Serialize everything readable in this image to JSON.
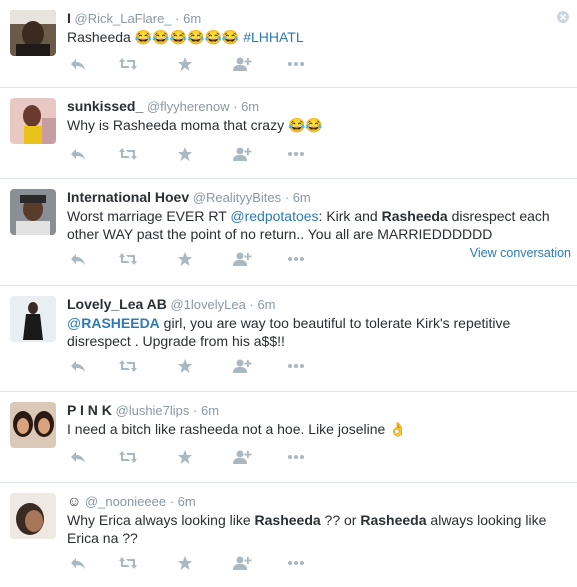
{
  "colors": {
    "link": "#2b7bb9",
    "meta": "#8899a6",
    "icon": "#aab8c2",
    "text": "#292f33",
    "divider": "#e1e8ed"
  },
  "tweets": [
    {
      "fullname": "I",
      "username": "@Rick_LaFlare_",
      "sep": "·",
      "time": "6m",
      "text_pre": "Rasheeda 😂😂😂😂😂😂 ",
      "hashtag": "#LHHATL"
    },
    {
      "fullname": "sunkissed_",
      "username": "@flyyherenow",
      "sep": "·",
      "time": "6m",
      "text": "Why is Rasheeda moma that crazy 😂😂"
    },
    {
      "fullname": "International Hoev",
      "username": "@RealityyBites",
      "sep": "·",
      "time": "6m",
      "text_a": "Worst marriage EVER RT ",
      "mention": "@redpotatoes",
      "text_b": ": Kirk and ",
      "bold": "Rasheeda",
      "text_c": " disrespect each other WAY past the point of no return.. You all are MARRIEDDDDDD",
      "view_conversation": "View conversation"
    },
    {
      "fullname": "Lovely_Lea AB",
      "username": "@1lovelyLea",
      "sep": "·",
      "time": "6m",
      "mention_prefix": "@",
      "mention_bold": "RASHEEDA",
      "text": " girl,  you are way too beautiful to tolerate Kirk's repetitive disrespect . Upgrade from his a$$!!"
    },
    {
      "fullname": "P I N K",
      "username": "@lushie7lips",
      "sep": "·",
      "time": "6m",
      "text": "I need a bitch like rasheeda not a hoe. Like joseline 👌"
    },
    {
      "fullname": "☺",
      "username": "@_noonieeee",
      "sep": "·",
      "time": "6m",
      "text_a": "Why Erica always looking like ",
      "bold_a": "Rasheeda",
      "text_b": " ?? or ",
      "bold_b": "Rasheeda",
      "text_c": " always looking like Erica na ??"
    }
  ],
  "action_icons": [
    "reply-icon",
    "retweet-icon",
    "favorite-icon",
    "follow-icon",
    "more-icon"
  ]
}
